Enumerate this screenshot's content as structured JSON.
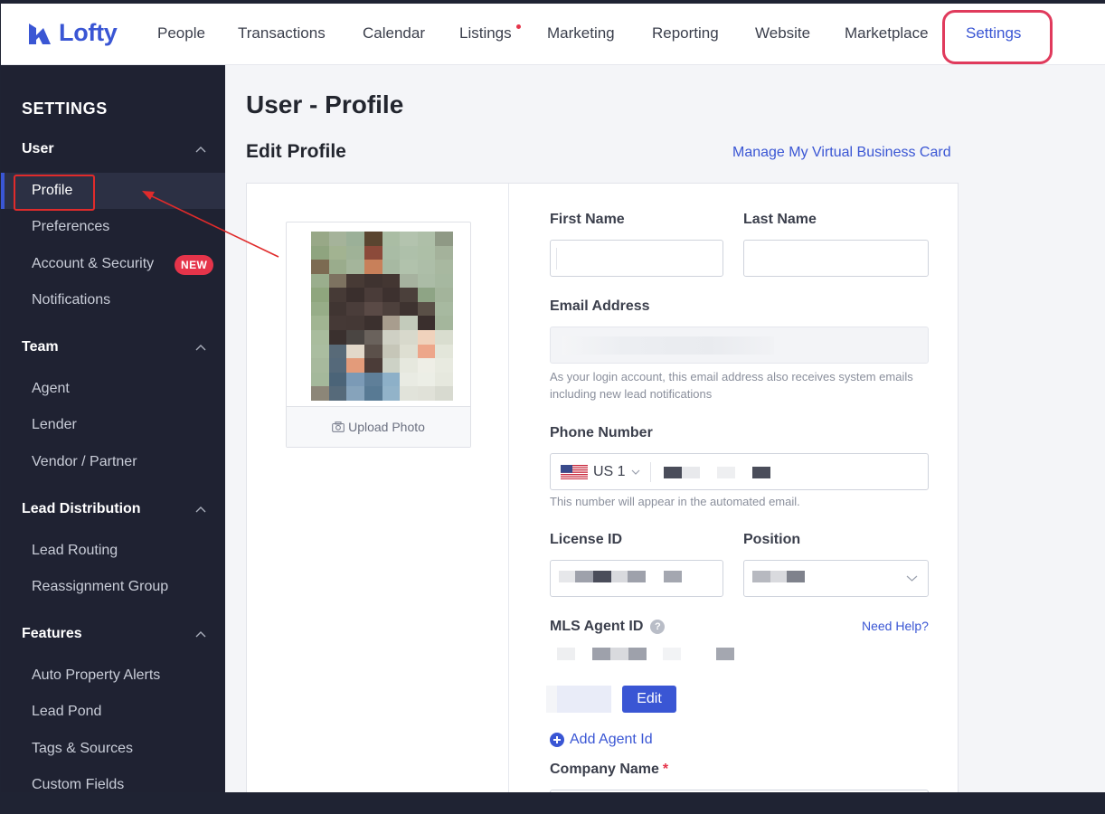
{
  "app": {
    "brand": "Lofty",
    "brand_color": "#3a56d4"
  },
  "topnav": {
    "items": [
      {
        "label": "People"
      },
      {
        "label": "Transactions"
      },
      {
        "label": "Calendar"
      },
      {
        "label": "Listings",
        "has_dot": true
      },
      {
        "label": "Marketing"
      },
      {
        "label": "Reporting"
      },
      {
        "label": "Website"
      },
      {
        "label": "Marketplace"
      },
      {
        "label": "Settings",
        "active": true
      }
    ]
  },
  "sidebar": {
    "heading": "SETTINGS",
    "groups": [
      {
        "title": "User",
        "items": [
          "Profile",
          "Preferences",
          "Account & Security",
          "Notifications"
        ]
      },
      {
        "title": "Team",
        "items": [
          "Agent",
          "Lender",
          "Vendor / Partner"
        ]
      },
      {
        "title": "Lead Distribution",
        "items": [
          "Lead Routing",
          "Reassignment Group"
        ]
      },
      {
        "title": "Features",
        "items": [
          "Auto Property Alerts",
          "Lead Pond",
          "Tags & Sources",
          "Custom Fields"
        ]
      }
    ],
    "active_item": "Profile",
    "new_badge": "NEW"
  },
  "main": {
    "page_title": "User - Profile",
    "section_title": "Edit Profile",
    "card_link": "Manage My Virtual Business Card",
    "photo": {
      "upload_label": "Upload Photo"
    },
    "form": {
      "first_name_label": "First Name",
      "last_name_label": "Last Name",
      "email_label": "Email Address",
      "email_hint": "As your login account, this email address also receives system emails including new lead notifications",
      "phone_label": "Phone Number",
      "phone_country": "US 1",
      "phone_hint": "This number will appear in the automated email.",
      "license_label": "License ID",
      "position_label": "Position",
      "mls_label": "MLS Agent ID",
      "need_help": "Need Help?",
      "edit_button": "Edit",
      "add_agent_id": "Add Agent Id",
      "company_label": "Company Name",
      "required_mark": "*"
    }
  }
}
